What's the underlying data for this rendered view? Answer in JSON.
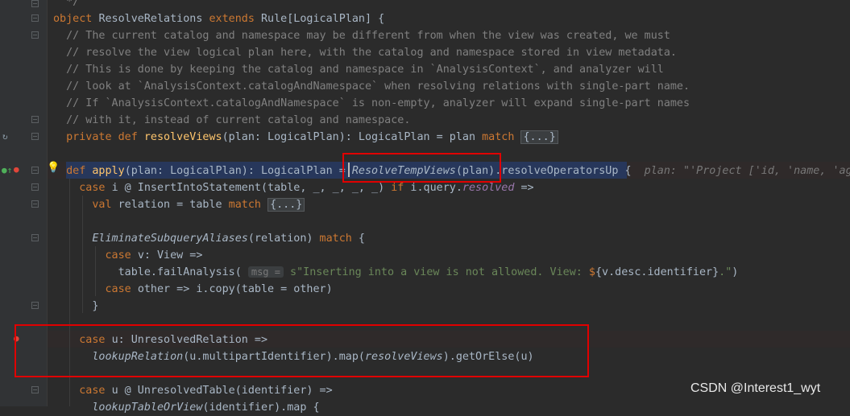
{
  "editor": {
    "lines": [
      {
        "segments": [
          {
            "t": "  */",
            "c": "cm"
          }
        ]
      },
      {
        "segments": [
          {
            "t": "object ",
            "c": "kw"
          },
          {
            "t": "ResolveRelations "
          },
          {
            "t": "extends ",
            "c": "kw"
          },
          {
            "t": "Rule[LogicalPlan] {"
          }
        ]
      },
      {
        "segments": [
          {
            "t": "  // The current catalog and namespace may be different from when the view was created, we must",
            "c": "cm"
          }
        ]
      },
      {
        "segments": [
          {
            "t": "  // resolve the view logical plan here, with the catalog and namespace stored in view metadata.",
            "c": "cm"
          }
        ]
      },
      {
        "segments": [
          {
            "t": "  // This is done by keeping the catalog and namespace in `AnalysisContext`, and analyzer will",
            "c": "cm"
          }
        ]
      },
      {
        "segments": [
          {
            "t": "  // look at `AnalysisContext.catalogAndNamespace` when resolving relations with single-part name.",
            "c": "cm"
          }
        ]
      },
      {
        "segments": [
          {
            "t": "  // If `AnalysisContext.catalogAndNamespace` is non-empty, analyzer will expand single-part names",
            "c": "cm"
          }
        ]
      },
      {
        "segments": [
          {
            "t": "  // with it, instead of current catalog and namespace.",
            "c": "cm"
          }
        ]
      },
      {
        "segments": [
          {
            "t": "  private def ",
            "c": "kw"
          },
          {
            "t": "resolveViews",
            "c": "fn"
          },
          {
            "t": "(plan: LogicalPlan): LogicalPlan = plan "
          },
          {
            "t": "match ",
            "c": "kw"
          },
          {
            "t": "{...}",
            "c": "fd"
          }
        ]
      },
      {
        "segments": []
      },
      {
        "segments": [
          {
            "t": "  def ",
            "c": "kw"
          },
          {
            "t": "apply",
            "c": "fn"
          },
          {
            "t": "(plan: LogicalPlan): LogicalPlan = "
          },
          {
            "t": "ResolveTempViews",
            "c": "it"
          },
          {
            "t": "(plan).resolveOperatorsUp {  "
          },
          {
            "t": "plan: \"'Project ['id, 'name, 'age",
            "c": "inl"
          }
        ]
      },
      {
        "segments": [
          {
            "t": "    case ",
            "c": "kw"
          },
          {
            "t": "i @ InsertIntoStatement(table, _, _, _, _) "
          },
          {
            "t": "if ",
            "c": "kw"
          },
          {
            "t": "i.query."
          },
          {
            "t": "resolved",
            "c": "pu"
          },
          {
            "t": " =>"
          }
        ]
      },
      {
        "segments": [
          {
            "t": "      val ",
            "c": "kw"
          },
          {
            "t": "relation = table "
          },
          {
            "t": "match ",
            "c": "kw"
          },
          {
            "t": "{...}",
            "c": "fd"
          }
        ]
      },
      {
        "segments": []
      },
      {
        "segments": [
          {
            "t": "      "
          },
          {
            "t": "EliminateSubqueryAliases",
            "c": "it"
          },
          {
            "t": "(relation) "
          },
          {
            "t": "match ",
            "c": "kw"
          },
          {
            "t": "{"
          }
        ]
      },
      {
        "segments": [
          {
            "t": "        case ",
            "c": "kw"
          },
          {
            "t": "v: View =>"
          }
        ]
      },
      {
        "segments": [
          {
            "t": "          table.failAnalysis( "
          },
          {
            "t": "msg =",
            "c": "hint"
          },
          {
            "t": " s\"Inserting into a view is not allowed. View: ",
            "c": "st"
          },
          {
            "t": "$",
            "c": "kw"
          },
          {
            "t": "{v.desc.identifier}"
          },
          {
            "t": ".\"",
            "c": "st"
          },
          {
            "t": ")"
          }
        ]
      },
      {
        "segments": [
          {
            "t": "        case ",
            "c": "kw"
          },
          {
            "t": "other => i.copy(table = other)"
          }
        ]
      },
      {
        "segments": [
          {
            "t": "      }"
          }
        ]
      },
      {
        "segments": []
      },
      {
        "segments": [
          {
            "t": "    case ",
            "c": "kw"
          },
          {
            "t": "u: UnresolvedRelation =>"
          }
        ]
      },
      {
        "segments": [
          {
            "t": "      "
          },
          {
            "t": "lookupRelation",
            "c": "it"
          },
          {
            "t": "(u.multipartIdentifier).map("
          },
          {
            "t": "resolveViews",
            "c": "it"
          },
          {
            "t": ").getOrElse(u)"
          }
        ]
      },
      {
        "segments": []
      },
      {
        "segments": [
          {
            "t": "    case ",
            "c": "kw"
          },
          {
            "t": "u @ UnresolvedTable(identifier) =>"
          }
        ]
      },
      {
        "segments": [
          {
            "t": "      "
          },
          {
            "t": "lookupTableOrView",
            "c": "it"
          },
          {
            "t": "(identifier).map {"
          }
        ]
      }
    ]
  },
  "watermark": "CSDN @Interest1_wyt",
  "colors": {
    "keyword": "#cc7832",
    "comment": "#808080",
    "function": "#ffc66d",
    "string": "#6a8759",
    "highlight_box": "#e00000"
  }
}
